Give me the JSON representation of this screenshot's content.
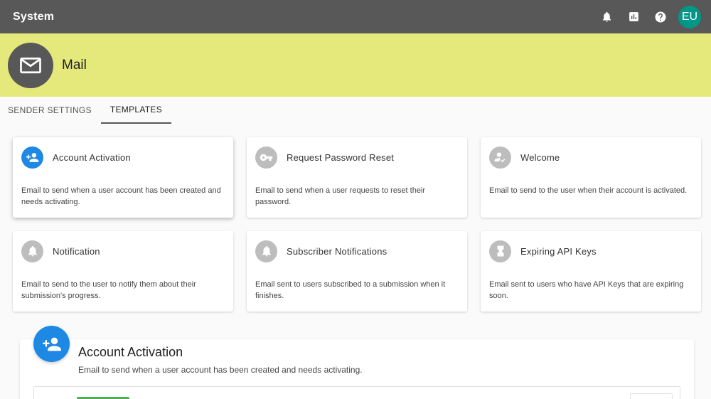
{
  "app": {
    "title": "System",
    "user_initials": "EU",
    "actions": [
      "notifications-icon",
      "chart-icon",
      "help-icon"
    ]
  },
  "banner": {
    "title": "Mail",
    "icon": "mail-icon"
  },
  "tabs": [
    {
      "label": "SENDER SETTINGS",
      "active": false
    },
    {
      "label": "TEMPLATES",
      "active": true
    }
  ],
  "templates": [
    {
      "title": "Account Activation",
      "description": "Email to send when a user account has been created and needs activating.",
      "icon": "person-add-icon",
      "selected": true
    },
    {
      "title": "Request Password Reset",
      "description": "Email to send when a user requests to reset their password.",
      "icon": "key-icon",
      "selected": false
    },
    {
      "title": "Welcome",
      "description": "Email to send to the user when their account is activated.",
      "icon": "person-check-icon",
      "selected": false
    },
    {
      "title": "Notification",
      "description": "Email to send to the user to notify them about their submission's progress.",
      "icon": "bell-icon",
      "selected": false
    },
    {
      "title": "Subscriber Notifications",
      "description": "Email sent to users subscribed to a submission when it finishes.",
      "icon": "bell-icon",
      "selected": false
    },
    {
      "title": "Expiring API Keys",
      "description": "Email sent to users who have API Keys that are expiring soon.",
      "icon": "hourglass-icon",
      "selected": false
    }
  ],
  "detail": {
    "title": "Account Activation",
    "description": "Email to send when a user account has been created and needs activating.",
    "icon": "person-add-icon"
  },
  "colors": {
    "appbar": "#585858",
    "banner": "#e5e97b",
    "accent": "#1e88e5",
    "avatar": "#009688"
  }
}
